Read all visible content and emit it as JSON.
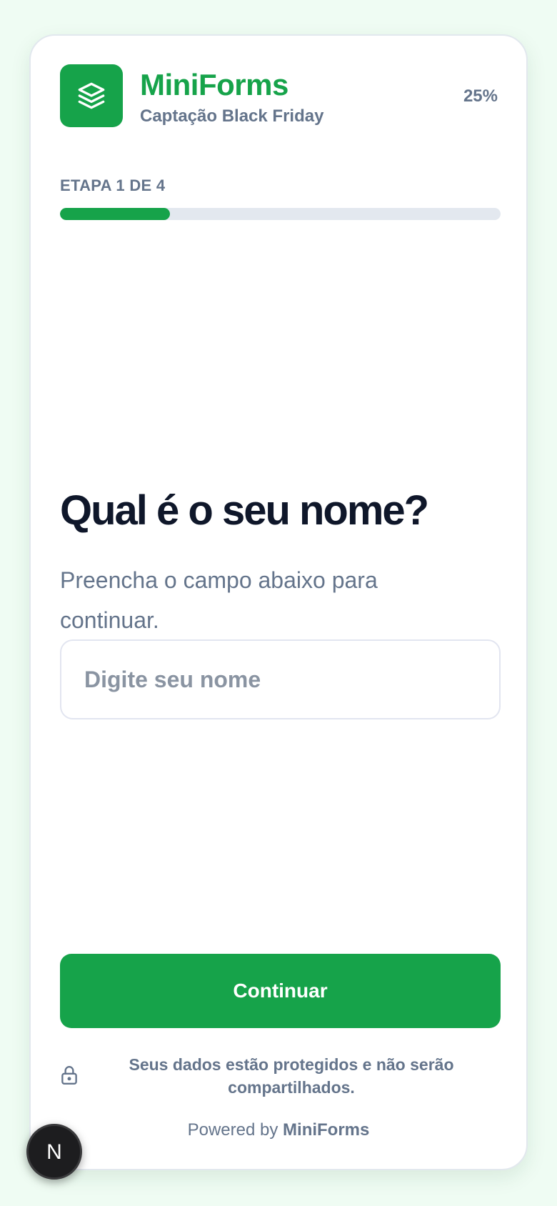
{
  "header": {
    "brand_name": "MiniForms",
    "subtitle": "Captação Black Friday",
    "percent_label": "25%",
    "logo_icon": "layers-icon"
  },
  "progress": {
    "step_label": "ETAPA 1 DE 4",
    "value": 0.25
  },
  "question": {
    "title": "Qual é o seu nome?",
    "helper": "Preencha o campo abaixo para continuar."
  },
  "input": {
    "placeholder": "Digite seu nome",
    "value": ""
  },
  "actions": {
    "continue_label": "Continuar"
  },
  "footer": {
    "privacy_icon": "lock-icon",
    "privacy_text": "Seus dados estão protegidos e não serão compartilhados.",
    "powered_prefix": "Powered by",
    "powered_brand": "MiniForms"
  },
  "dev_badge": {
    "icon": "nextjs-icon",
    "letter": "N"
  },
  "colors": {
    "accent": "#16a34a",
    "background": "#effcf3",
    "text_muted": "#64748b",
    "text_dark": "#0f172a",
    "track": "#e3e8ef"
  }
}
